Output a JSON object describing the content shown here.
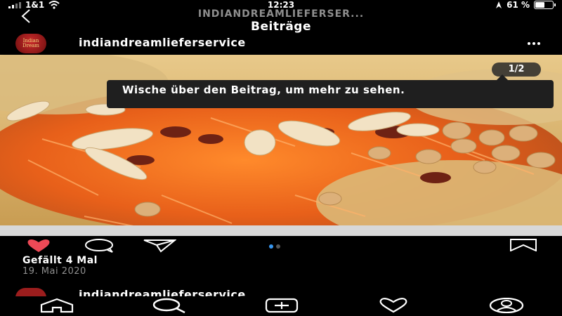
{
  "status_bar": {
    "carrier": "1&1",
    "time": "12:23",
    "battery": "61 %",
    "battery_level": 0.61
  },
  "nav": {
    "back_icon": "chevron-left-icon",
    "subtitle": "INDIANDREAMLIEFERSER...",
    "title": "Beiträge"
  },
  "post": {
    "username": "indiandreamlieferservice",
    "avatar_text": "Indian Dream",
    "more_icon": "more-horizontal-icon",
    "image_counter": "1/2",
    "tooltip": "Wische über den Beitrag, um mehr zu sehen.",
    "likes": "Gefällt 4 Mal",
    "date": "19. Mai 2020",
    "carousel": {
      "total": 2,
      "active": 1
    },
    "actions": {
      "like_icon": "heart-filled-icon",
      "comment_icon": "comment-icon",
      "share_icon": "send-icon",
      "save_icon": "bookmark-icon"
    }
  },
  "next_post": {
    "username": "indiandreamlieferservice"
  },
  "tab_bar": [
    "home-icon",
    "search-icon",
    "add-post-icon",
    "activity-heart-icon",
    "profile-icon"
  ],
  "colors": {
    "background": "#000000",
    "like_red": "#ed4956",
    "accent_blue": "#3897f0",
    "secondary_text": "#8e8e8e"
  }
}
